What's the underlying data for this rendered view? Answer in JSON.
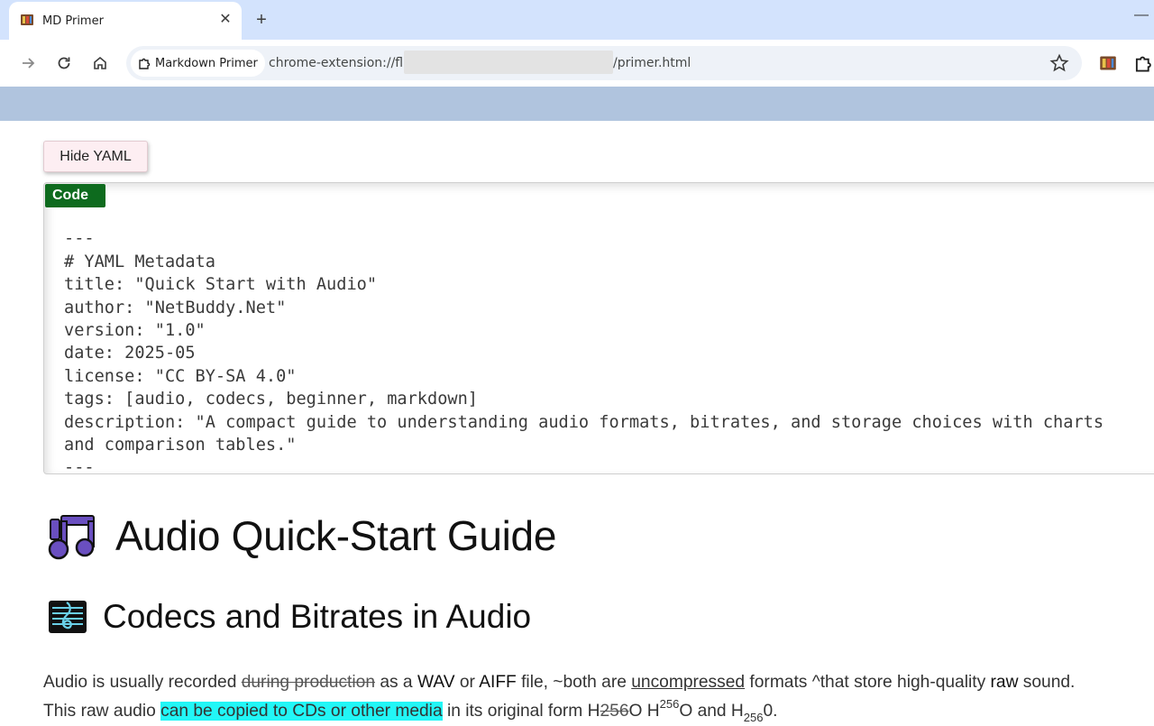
{
  "browser": {
    "tab": {
      "title": "MD Primer",
      "close_glyph": "✕",
      "favicon": "extension-book-icon"
    },
    "new_tab_glyph": "+",
    "minimize_glyph": "—",
    "omnibox": {
      "chip_label": "Markdown Primer",
      "url_prefix": "chrome-extension://fl",
      "url_suffix": "/primer.html"
    }
  },
  "page": {
    "toggle_button": "Hide YAML",
    "code_badge": "Code",
    "yaml_lines": [
      "---",
      "# YAML Metadata",
      "title: \"Quick Start with Audio\"",
      "author: \"NetBuddy.Net\"",
      "version: \"1.0\"",
      "date: 2025-05",
      "license: \"CC BY-SA 4.0\"",
      "tags: [audio, codecs, beginner, markdown]",
      "description: \"A compact guide to understanding audio formats, bitrates, and storage choices with charts",
      "and comparison tables.\"",
      "---"
    ],
    "h1": "Audio Quick-Start Guide",
    "h2": "Codecs and Bitrates in Audio",
    "paragraph": {
      "p1": "Audio is usually recorded ",
      "p1_strike": "during production",
      "p2": " as a ",
      "p2_wav": "WAV",
      "p3": " or ",
      "p3_aiff": "AIFF",
      "p4": " file, ~both are ",
      "p4_under": "uncompressed",
      "p5": " formats ^that store high-quality ",
      "p5_raw": "raw",
      "p6": " sound.",
      "l2a": "This raw audio ",
      "l2_highlight": "can be copied to CDs or other media",
      "l2b": " in its original form H",
      "l2_strike": "256",
      "l2c": "O H",
      "l2_sup": "256",
      "l2d": "O and H",
      "l2_sub": "256",
      "l2e": "0."
    }
  },
  "colors": {
    "tabstrip": "#d3e3fd",
    "banner": "#b0c4de",
    "code_badge": "#0e6b1e",
    "button_bg": "#fdeef2",
    "highlight": "#22f6f6",
    "heading_icon": "#6a4fc0"
  }
}
